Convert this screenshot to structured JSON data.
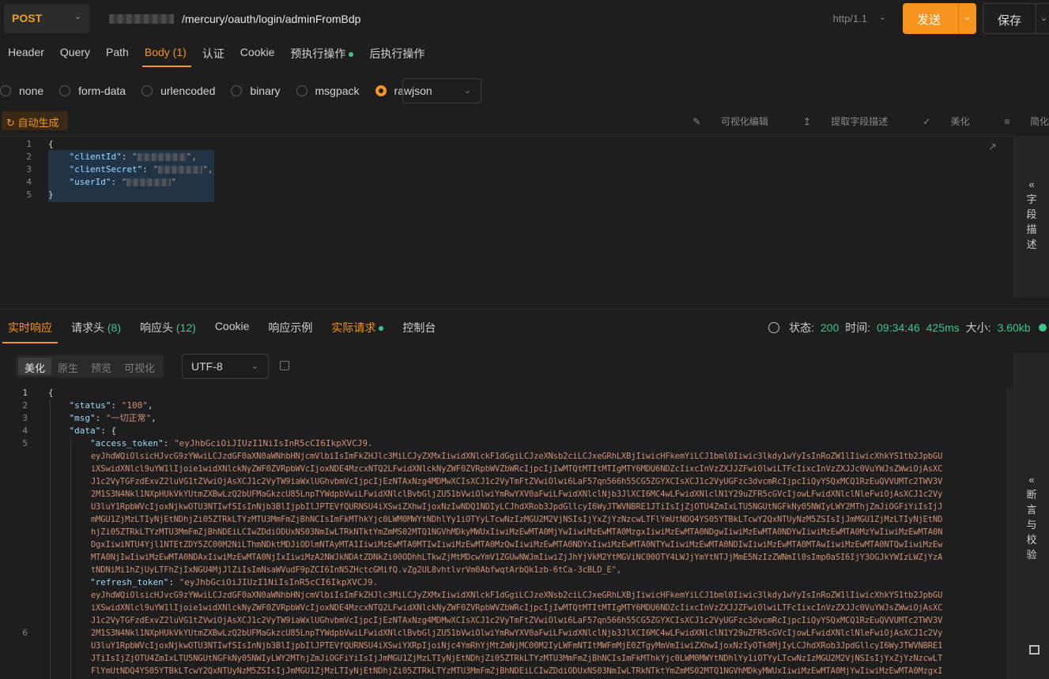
{
  "request": {
    "method": "POST",
    "url_path": "/mercury/oauth/login/adminFromBdp",
    "http_version": "http/1.1",
    "send_label": "发送",
    "save_label": "保存"
  },
  "request_tabs": [
    {
      "label": "Header"
    },
    {
      "label": "Query"
    },
    {
      "label": "Path"
    },
    {
      "label": "Body",
      "count": "(1)"
    },
    {
      "label": "认证"
    },
    {
      "label": "Cookie"
    },
    {
      "label": "预执行操作"
    },
    {
      "label": "后执行操作"
    }
  ],
  "body_types": [
    "none",
    "form-data",
    "urlencoded",
    "binary",
    "msgpack",
    "raw"
  ],
  "body_type_selected": "raw",
  "body_format": "json",
  "auto_generate_label": "自动生成",
  "editor_tools": [
    "可视化编辑",
    "提取字段描述",
    "美化",
    "简化"
  ],
  "request_body": {
    "line_numbers": [
      "1",
      "2",
      "3",
      "4",
      "5"
    ],
    "open_brace": "{",
    "close_brace": "}",
    "key1": "\"clientId\"",
    "key2": "\"clientSecret\"",
    "key3": "\"userId\""
  },
  "field_desc_label": "字段描述",
  "response_tabs": [
    {
      "label": "实时响应"
    },
    {
      "label": "请求头",
      "count": "(8)"
    },
    {
      "label": "响应头",
      "count": "(12)"
    },
    {
      "label": "Cookie"
    },
    {
      "label": "响应示例"
    },
    {
      "label": "实际请求"
    },
    {
      "label": "控制台"
    }
  ],
  "status": {
    "status_label": "状态:",
    "status_value": "200",
    "time_label": "时间:",
    "time_value": "09:34:46",
    "duration": "425ms",
    "size_label": "大小:",
    "size_value": "3.60kb"
  },
  "view_modes": [
    "美化",
    "原生",
    "预览",
    "可视化"
  ],
  "encoding": "UTF-8",
  "assert_label": "断言与校验",
  "response_body": {
    "lines": [
      "1",
      "2",
      "3",
      "4",
      "5",
      "6"
    ],
    "l1": "{",
    "status_key": "\"status\"",
    "status_val": "\"100\"",
    "msg_key": "\"msg\"",
    "msg_val": "\"一切正常\"",
    "data_key": "\"data\"",
    "access_key": "\"access_token\"",
    "access_first": "\"eyJhbGciOiJIUzI1NiIsInR5cCI6IkpXVCJ9.",
    "access_wrap": [
      "eyJhdWQiOlsicHJvcG9zYWwiLCJzdGF0aXN0aWNhbHNjcmVlbiIsImFkZHJlc3MiLCJyZXMxIiwidXNlckF1dGgiLCJzeXNsb2ciLCJxeGRhLXBjIiwicHFkemYiLCJ1bml0Iiwic3lkdy1wYyIsInRoZW1lIiwicXhkYS1tb2JpbGU",
      "iXSwidXNlcl9uYW1lIjoie1widXNlckNyZWF0ZVRpbWVcIjoxNDE4MzcxNTQ2LFwidXNlckNyZWF0ZVRpbWVZbWRcIjpcIjIwMTQtMTItMTIgMTY6MDU6NDZcIixcInVzZXJJZFwiOlwiLTFcIixcInVzZXJJc0VuYWJsZWwiOjAsXC",
      "J1c2VyTGFzdExvZ2luVG1tZVwiOjAsXCJ1c2VyTW9iaWxlUGhvbmVcIjpcIjEzNTAxNzg4MDMwXCIsXCJ1c2VyTmFtZVwiOlwi6LaF57qn566h55CG5ZGYXCIsXCJ1c2VyUGFzc3dvcmRcIjpcIiQyYSQxMCQ1RzEuQVVUMTc2TWV3V",
      "2M1S3N4Nkl1NXpHUkVkYUtmZXBwLzQ2bUFMaGkzcU85LnpTYWdpbVwiLFwidXNlclBvbGljZU51bVwiOlwiYmRwYXV0aFwiLFwidXNlclNjb3JlXCI6MC4wLFwidXNlclN1Y29uZFR5cGVcIjowLFwidXNlclNleFwiOjAsXCJ1c2Vy",
      "U3luY1RpbWVcIjoxNjkwOTU3NTIwfSIsInNjb3BlIjpbIlJPTEVfQURNSU4iXSwiZXhwIjoxNzIwNDQ1NDIyLCJhdXRob3JpdGllcyI6WyJTWVNBRE1JTiIsIjZjOTU4ZmIxLTU5NGUtNGFkNy05NWIyLWY2MThjZmJiOGFiYiIsIjJ",
      "mMGU1ZjMzLTIyNjEtNDhjZi05ZTRkLTYzMTU3MmFmZjBhNCIsImFkMThkYjc0LWM0MWYtNDhlYy1iOTYyLTcwNzIzMGU2M2VjNSIsIjYxZjYzNzcwLTFlYmUtNDQ4YS05YTBkLTcwY2QxNTUyNzM5ZSIsIjJmMGU1ZjMzLTIyNjEtND",
      "hjZi05ZTRkLTYzMTU3MmFmZjBhNDEiLCIwZDdiODUxNS03NmIwLTRkNTktYmZmMS02MTQ1NGVhMDkyMWUxIiwiMzEwMTA0MjYwIiwiMzEwMTA0MzgxIiwiMzEwMTA0NDgwIiwiMzEwMTA0NDYwIiwiMzEwMTA0MzYwIiwiMzEwMTA0N",
      "DgxIiwiNTU4Yjl1NTEtZDY5ZC00M2NiLThmNDktMDJiODlmNTAyMTA1IiwiMzEwMTA0MTIwIiwiMzEwMTA0MzQwIiwiMzEwMTA0NDYxIiwiMzEwMTA0NTYwIiwiMzEwMTA0NDIwIiwiMzEwMTA0MTAwIiwiMzEwMTA0NTQwIiwiMzEw",
      "MTA0NjIwIiwiMzEwMTA0NDAxIiwiMzEwMTA0NjIxIiwiMzA2NWJkNDAtZDNkZi00ODhhLTkwZjMtMDcwYmV1ZGUwNWJmIiwiZjJhYjVkM2YtMGViNC00OTY4LWJjYmYtNTJjMmE5NzIzZWNmIl0sImp0aSI6IjY3OGJkYWIzLWZjYzA",
      "tNDNiMi1hZjUyLTFhZjIxNGU4MjJlZiIsImNsaWVudF9pZCI6InN5ZHctcGMifQ.vZg2UL8vhtlvrVm0AbfwqtArbQk1zb-6tCa-3cBLD_E\","
    ],
    "refresh_key": "\"refresh_token\"",
    "refresh_first": "\"eyJhbGciOiJIUzI1NiIsInR5cCI6IkpXVCJ9.",
    "refresh_wrap": [
      "eyJhdWQiOlsicHJvcG9zYWwiLCJzdGF0aXN0aWNhbHNjcmVlbiIsImFkZHJlc3MiLCJyZXMxIiwidXNlckF1dGgiLCJzeXNsb2ciLCJxeGRhLXBjIiwicHFkemYiLCJ1bml0Iiwic3lkdy1wYyIsInRoZW1lIiwicXhkYS1tb2JpbGU",
      "iXSwidXNlcl9uYW1lIjoie1widXNlckNyZWF0ZVRpbWVcIjoxNDE4MzcxNTQ2LFwidXNlckNyZWF0ZVRpbWVZbWRcIjpcIjIwMTQtMTItMTIgMTY6MDU6NDZcIixcInVzZXJJZFwiOlwiLTFcIixcInVzZXJJc0VuYWJsZWwiOjAsXC",
      "J1c2VyTGFzdExvZ2luVG1tZVwiOjAsXCJ1c2VyTW9iaWxlUGhvbmVcIjpcIjEzNTAxNzg4MDMwXCIsXCJ1c2VyTmFtZVwiOlwi6LaF57qn566h55CG5ZGYXCIsXCJ1c2VyUGFzc3dvcmRcIjpcIiQyYSQxMCQ1RzEuQVVUMTc2TWV3V",
      "2M1S3N4Nkl1NXpHUkVkYUtmZXBwLzQ2bUFMaGkzcU85LnpTYWdpbVwiLFwidXNlclBvbGljZU51bVwiOlwiYmRwYXV0aFwiLFwidXNlclNjb3JlXCI6MC4wLFwidXNlclN1Y29uZFR5cGVcIjowLFwidXNlclNleFwiOjAsXCJ1c2Vy",
      "U3luY1RpbWVcIjoxNjkwOTU3NTIwfSIsInNjb3BlIjpbIlJPTEVfQURNSU4iXSwiYXRpIjoiNjc4YmRhYjMtZmNjMC00M2IyLWFmNTItMWFmMjE0ZTgyMmVmIiwiZXhwIjoxNzIyOTk0MjIyLCJhdXRob3JpdGllcyI6WyJTWVNBRE1",
      "JTiIsIjZjOTU4ZmIxLTU5NGUtNGFkNy05NWIyLWY2MThjZmJiOGFiYiIsIjJmMGU1ZjMzLTIyNjEtNDhjZi05ZTRkLTYzMTU3MmFmZjBhNCIsImFkMThkYjc0LWM0MWYtNDhlYy1iOTYyLTcwNzIzMGU2M2VjNSIsIjYxZjYzNzcwLT",
      "FlYmUtNDQ4YS05YTBkLTcwY2QxNTUyNzM5ZSIsIjJmMGU1ZjMzLTIyNjEtNDhjZi05ZTRkLTYzMTU3MmFmZjBhNDEiLCIwZDdiODUxNS03NmIwLTRkNTktYmZmMS02MTQ1NGVhMDkyMWUxIiwiMzEwMTA0MjYwIiwiMzEwMTA0MzgxI"
    ]
  }
}
